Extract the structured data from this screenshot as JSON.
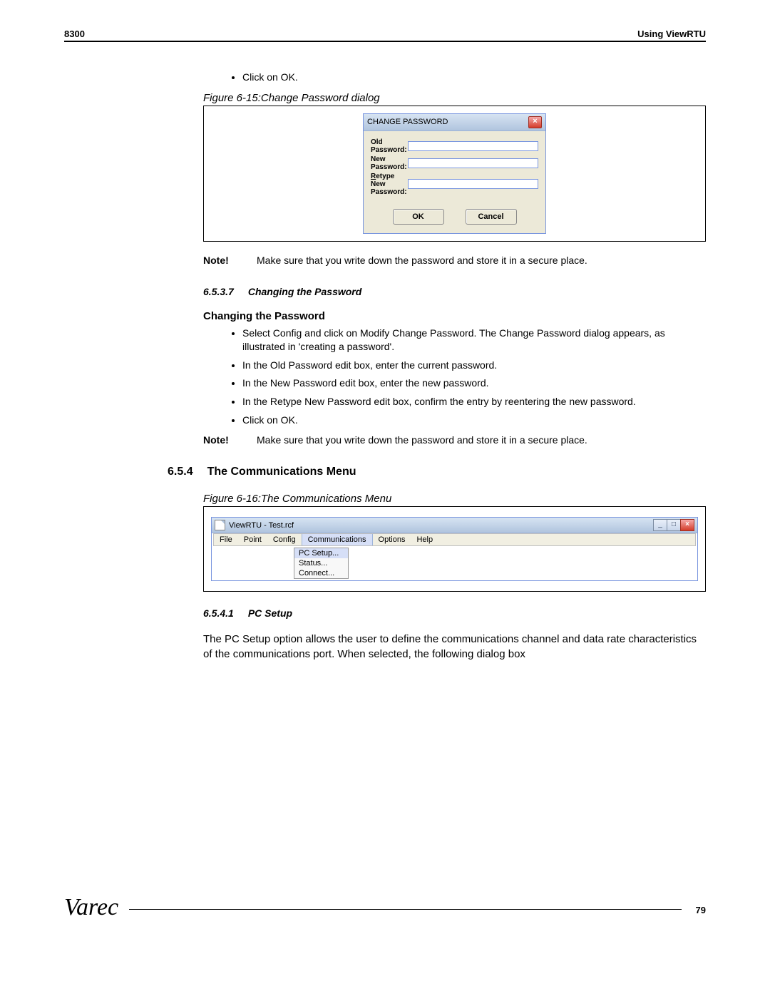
{
  "header": {
    "left": "8300",
    "right": "Using ViewRTU"
  },
  "intro_bullet": "Click on OK.",
  "fig1": {
    "caption": "Figure 6-15:Change Password dialog",
    "dialog_title": "CHANGE PASSWORD",
    "labels": {
      "old": "Old Password:",
      "new": "New Password:",
      "retype": "Retype New Password:"
    },
    "ok": "OK",
    "cancel": "Cancel"
  },
  "note1": {
    "label": "Note!",
    "text": "Make sure that you write down the password and store it in a secure place."
  },
  "sec6537": {
    "num": "6.5.3.7",
    "title": "Changing the Password"
  },
  "cp_heading": "Changing the Password",
  "cp_bullets": [
    "Select Config and click on Modify Change Password. The Change Password dialog appears, as illustrated in 'creating a password'.",
    "In the Old Password edit box, enter the current password.",
    "In the New Password edit box, enter the new password.",
    "In the Retype New Password edit box, confirm the entry by reentering the new password.",
    "Click on OK."
  ],
  "note2": {
    "label": "Note!",
    "text": "Make sure that you write down the password and store it in a secure place."
  },
  "sec654": {
    "num": "6.5.4",
    "title": "The Communications Menu"
  },
  "fig2": {
    "caption": "Figure 6-16:The Communications Menu",
    "win_title": "ViewRTU - Test.rcf",
    "menus": [
      "File",
      "Point",
      "Config",
      "Communications",
      "Options",
      "Help"
    ],
    "dropdown": [
      "PC Setup...",
      "Status...",
      "Connect..."
    ]
  },
  "sec6541": {
    "num": "6.5.4.1",
    "title": "PC Setup"
  },
  "pc_setup_para": "The PC Setup option allows the user to define the communications channel and data rate characteristics of the communications port. When selected, the following dialog box",
  "footer": {
    "logo": "Varec",
    "page": "79"
  }
}
